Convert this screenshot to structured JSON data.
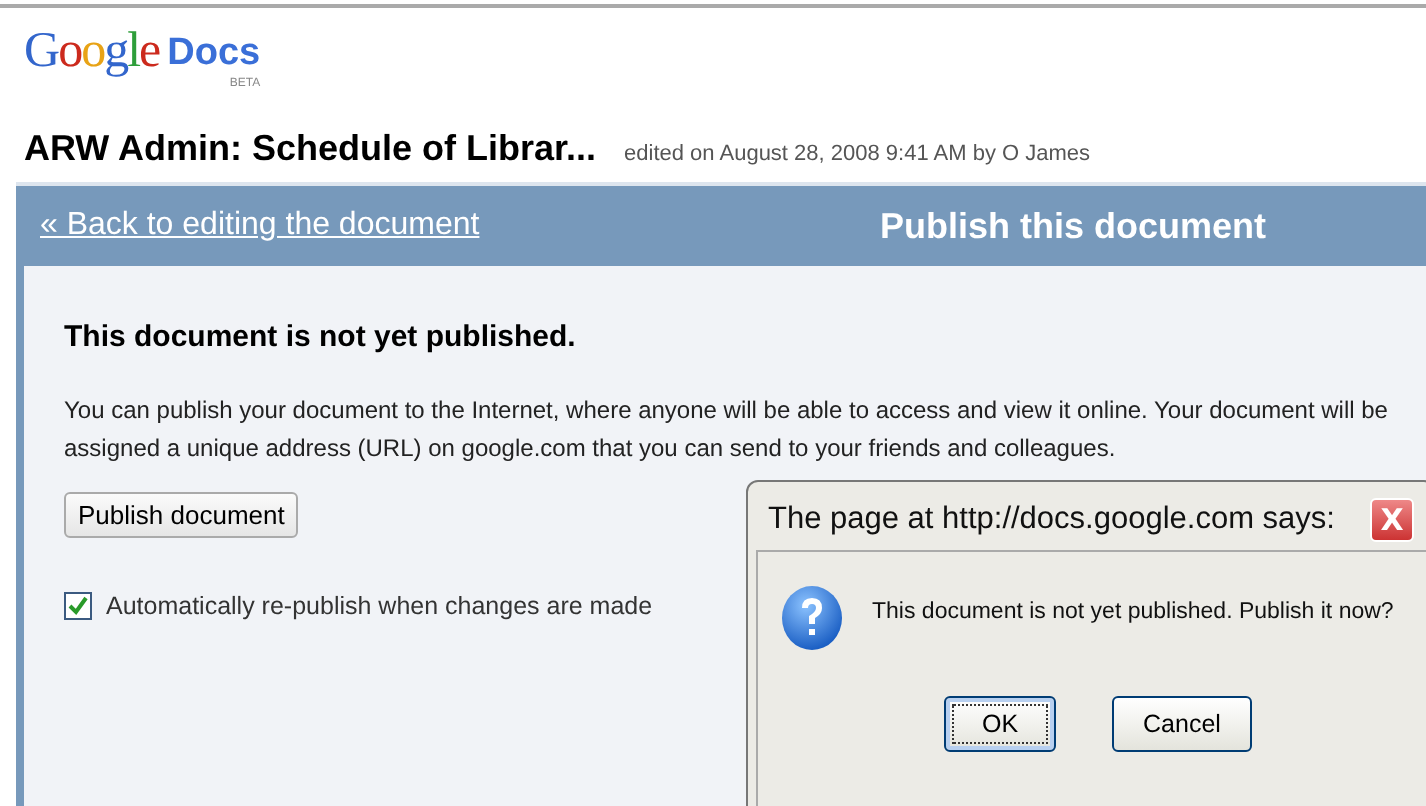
{
  "logo": {
    "brand": "Google",
    "product": "Docs",
    "badge": "BETA"
  },
  "document": {
    "title": "ARW Admin: Schedule of Librar...",
    "edited": "edited on August 28, 2008 9:41 AM by O James"
  },
  "bar": {
    "back_link": "« Back to editing the document",
    "heading": "Publish this document"
  },
  "panel": {
    "status": "This document is not yet published.",
    "description": "You can publish your document to the Internet, where anyone will be able to access and view it online. Your document will be assigned a unique address (URL) on google.com that you can send to your friends and colleagues.",
    "publish_button": "Publish document",
    "auto_republish": {
      "label": "Automatically re-publish when changes are made",
      "checked": true
    }
  },
  "dialog": {
    "title": "The page at http://docs.google.com says:",
    "close": "X",
    "message": "This document is not yet published. Publish it now?",
    "buttons": [
      {
        "label": "OK",
        "selected": true
      },
      {
        "label": "Cancel",
        "selected": false
      }
    ]
  }
}
